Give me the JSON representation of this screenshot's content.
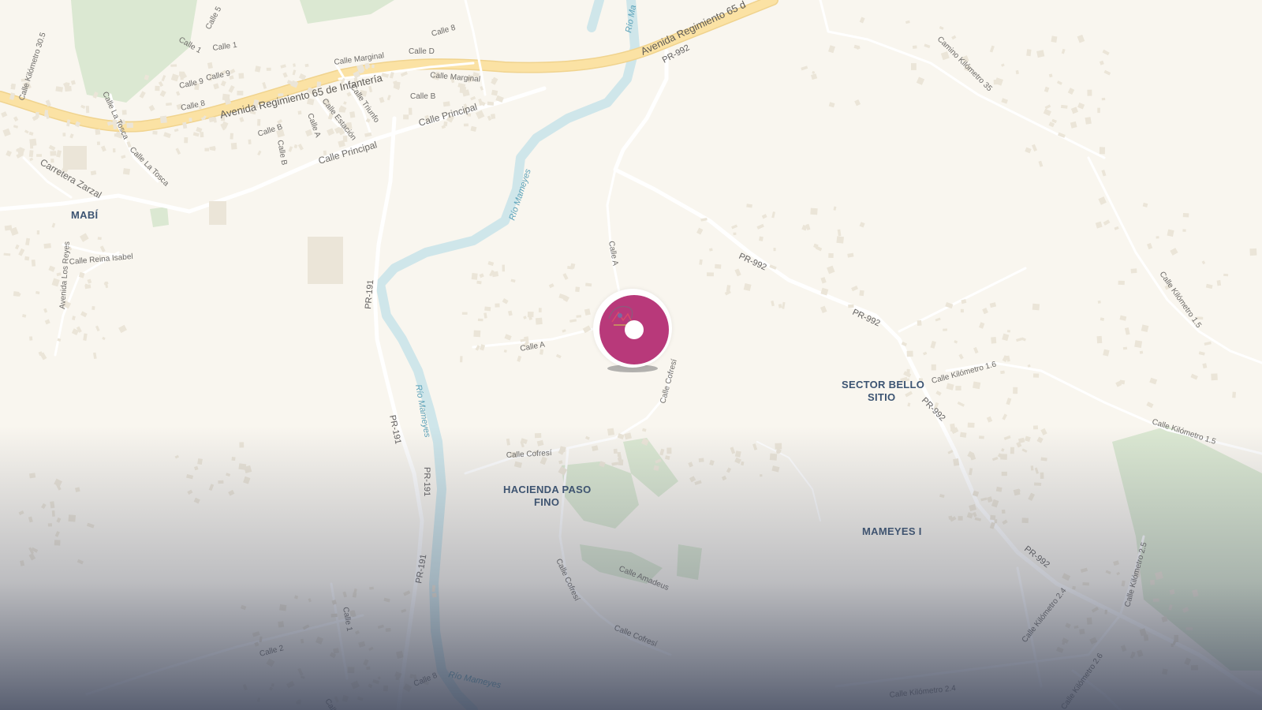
{
  "map": {
    "places": {
      "mabi": "MABÍ",
      "bello_1": "SECTOR BELLO",
      "bello_2": "SITIO",
      "hacienda_1": "HACIENDA PASO",
      "hacienda_2": "FINO",
      "mameyes": "MAMEYES I"
    },
    "rivers": {
      "a": "Río Mameyes",
      "b": "Río Mameyes",
      "c": "Río Mameyes",
      "top": "Río Ma"
    },
    "highways": {
      "avenida": "Avenida Regimiento 65 de Infantería",
      "avenida_e": "Avenida Regimiento 65 d",
      "principal_e": "Calle Principal",
      "principal_w": "Calle Principal",
      "zarzal": "Carretera Zarzal"
    },
    "routes": {
      "pr992_a": "PR-992",
      "pr992_b": "PR-992",
      "pr992_c": "PR-992",
      "pr992_d": "PR-992",
      "pr992_e": "PR-992",
      "pr191_a": "PR-191",
      "pr191_b": "PR-191",
      "pr191_c": "PR-191",
      "pr191_d": "PR-191"
    },
    "streets": {
      "calle1_a": "Calle 1",
      "calle1_b": "Calle 1",
      "calle5": "Calle 5",
      "calle8_a": "Calle 8",
      "calle8_b": "Calle 8",
      "calle8_c": "Calle 8",
      "calle9_a": "Calle 9",
      "calle9_b": "Calle 9",
      "called": "Calle D",
      "calleb_a": "Calle B",
      "calleb_b": "Calle B",
      "calleb_c": "Calle B",
      "callea_a": "Calle A",
      "callea_b": "Calle A",
      "callea_c": "Calle A",
      "marginal_a": "Calle Marginal",
      "marginal_b": "Calle Marginal",
      "triunfo": "Calle Triunfo",
      "estacion": "Calle Estación",
      "latosca_a": "Calle La Tosca",
      "latosca_b": "Calle La Tosca",
      "km305": "Calle Kilómetro 30.5",
      "reina": "Calle Reina Isabel",
      "losreyes": "Avenida Los Reyes",
      "cofresi_a": "Calle Cofresí",
      "cofresi_b": "Calle Cofresí",
      "cofresi_c": "Calle Cofresí",
      "cofresi_d": "Calle Cofresí",
      "amadeus": "Calle Amadeus",
      "km16": "Calle Kilómetro 1.6",
      "km15_a": "Calle Kilómetro 1.5",
      "km15_b": "Calle Kilómetro 1.5",
      "km24_a": "Calle Kilómetro 2.4",
      "km24_b": "Calle Kilómetro 2.4",
      "km25": "Calle Kilómetro 2.5",
      "km26": "Calle Kilómetro 2.6",
      "camino": "Camino Kilómetro 35",
      "calle2": "Calle 2",
      "calle1_c": "Calle 1",
      "callec": "Calle"
    }
  },
  "marker": {
    "name": "location-marker",
    "color": "#b8397a"
  },
  "colors": {
    "background": "#f9f6ef",
    "highway": "#fbe2a4",
    "road": "#ffffff",
    "water": "#cfe6ea",
    "park": "#dbe8d2",
    "building": "#ebe5d8",
    "fade": "#3e465c"
  }
}
